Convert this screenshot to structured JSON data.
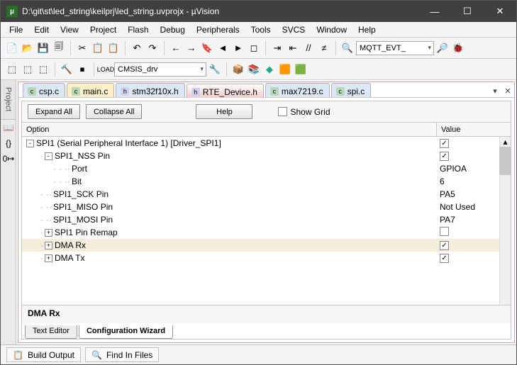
{
  "window": {
    "title": "D:\\git\\st\\led_string\\keilprj\\led_string.uvprojx - µVision"
  },
  "menu": [
    "File",
    "Edit",
    "View",
    "Project",
    "Flash",
    "Debug",
    "Peripherals",
    "Tools",
    "SVCS",
    "Window",
    "Help"
  ],
  "toolbar_combo": "MQTT_EVT_",
  "target_combo": "CMSIS_drv",
  "left_tab": "Project",
  "file_tabs": [
    {
      "label": "csp.c",
      "cls": "blue",
      "dot": "c"
    },
    {
      "label": "main.c",
      "cls": "yellow",
      "dot": "c"
    },
    {
      "label": "stm32f10x.h",
      "cls": "blue",
      "dot": "h"
    },
    {
      "label": "RTE_Device.h",
      "cls": "red",
      "dot": "h"
    },
    {
      "label": "max7219.c",
      "cls": "blue",
      "dot": "c"
    },
    {
      "label": "spi.c",
      "cls": "blue",
      "dot": "c"
    }
  ],
  "cfg": {
    "expand": "Expand All",
    "collapse": "Collapse All",
    "help": "Help",
    "showgrid": "Show Grid",
    "col_option": "Option",
    "col_value": "Value"
  },
  "rows": [
    {
      "indent": 0,
      "box": "-",
      "label": "SPI1 (Serial Peripheral Interface 1) [Driver_SPI1]",
      "value_type": "check",
      "value": "✓"
    },
    {
      "indent": 1,
      "box": "-",
      "label": "SPI1_NSS Pin",
      "value_type": "check",
      "value": "✓"
    },
    {
      "indent": 2,
      "box": "",
      "label": "Port",
      "value_type": "text",
      "value": "GPIOA"
    },
    {
      "indent": 2,
      "box": "",
      "label": "Bit",
      "value_type": "text",
      "value": "6"
    },
    {
      "indent": 1,
      "box": "",
      "label": "SPI1_SCK Pin",
      "value_type": "text",
      "value": "PA5"
    },
    {
      "indent": 1,
      "box": "",
      "label": "SPI1_MISO Pin",
      "value_type": "text",
      "value": "Not Used"
    },
    {
      "indent": 1,
      "box": "",
      "label": "SPI1_MOSI Pin",
      "value_type": "text",
      "value": "PA7"
    },
    {
      "indent": 1,
      "box": "+",
      "label": "SPI1 Pin Remap",
      "value_type": "check",
      "value": ""
    },
    {
      "indent": 1,
      "box": "+",
      "label": "DMA Rx",
      "value_type": "check",
      "value": "✓",
      "sel": true
    },
    {
      "indent": 1,
      "box": "+",
      "label": "DMA Tx",
      "value_type": "check",
      "value": "✓"
    }
  ],
  "status": "DMA Rx",
  "bottom_tabs": {
    "text": "Text Editor",
    "wiz": "Configuration Wizard"
  },
  "output_tabs": {
    "build": "Build Output",
    "find": "Find In Files"
  }
}
